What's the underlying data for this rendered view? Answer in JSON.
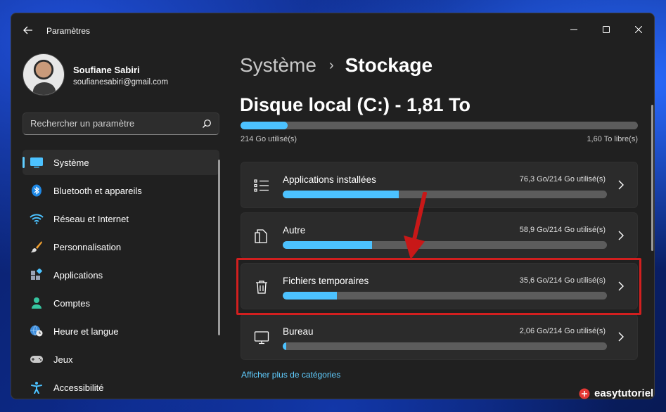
{
  "window": {
    "title": "Paramètres"
  },
  "user": {
    "name": "Soufiane Sabiri",
    "email": "soufianesabiri@gmail.com"
  },
  "search": {
    "placeholder": "Rechercher un paramètre"
  },
  "sidebar": {
    "items": [
      {
        "label": "Système",
        "icon": "system-icon",
        "active": true
      },
      {
        "label": "Bluetooth et appareils",
        "icon": "bluetooth-icon"
      },
      {
        "label": "Réseau et Internet",
        "icon": "wifi-icon"
      },
      {
        "label": "Personnalisation",
        "icon": "paintbrush-icon"
      },
      {
        "label": "Applications",
        "icon": "apps-icon"
      },
      {
        "label": "Comptes",
        "icon": "person-icon"
      },
      {
        "label": "Heure et langue",
        "icon": "globe-clock-icon"
      },
      {
        "label": "Jeux",
        "icon": "gamepad-icon"
      },
      {
        "label": "Accessibilité",
        "icon": "accessibility-icon"
      }
    ]
  },
  "breadcrumb": {
    "parent": "Système",
    "separator": "›",
    "current": "Stockage"
  },
  "disk": {
    "title": "Disque local (C:) - 1,81 To",
    "used_label": "214 Go utilisé(s)",
    "free_label": "1,60 To libre(s)",
    "used_fraction": 0.118
  },
  "categories": [
    {
      "label": "Applications installées",
      "size": "76,3 Go/214 Go utilisé(s)",
      "fraction": 0.357,
      "icon": "list-icon"
    },
    {
      "label": "Autre",
      "size": "58,9 Go/214 Go utilisé(s)",
      "fraction": 0.275,
      "icon": "document-icon"
    },
    {
      "label": "Fichiers temporaires",
      "size": "35,6 Go/214 Go utilisé(s)",
      "fraction": 0.166,
      "icon": "trash-icon"
    },
    {
      "label": "Bureau",
      "size": "2,06 Go/214 Go utilisé(s)",
      "fraction": 0.01,
      "icon": "monitor-icon"
    }
  ],
  "more_link": "Afficher plus de catégories",
  "watermark": "easytutoriel",
  "colors": {
    "accent": "#60cdff",
    "bar_fill": "#4cc2ff",
    "highlight": "#d21f1f"
  }
}
